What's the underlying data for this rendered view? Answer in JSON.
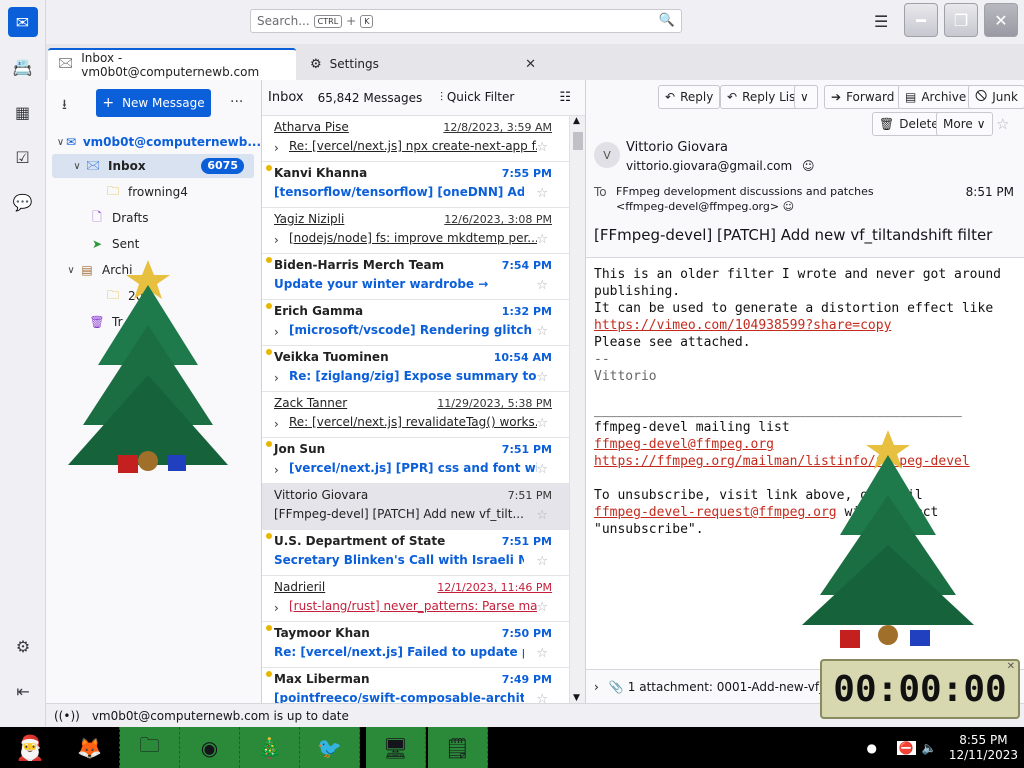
{
  "window": {
    "search_placeholder": "Search...",
    "shortcut_ctrl": "CTRL",
    "shortcut_plus": "+",
    "shortcut_k": "K"
  },
  "tabs": [
    {
      "label": "Inbox - vm0b0t@computernewb.com"
    },
    {
      "label": "Settings"
    }
  ],
  "folder_pane": {
    "new_message": "New Message",
    "more": "...",
    "account": "vm0b0t@computernewb...",
    "folders": [
      {
        "label": "Inbox",
        "badge": "6075"
      },
      {
        "label": "frowning4"
      },
      {
        "label": "Drafts"
      },
      {
        "label": "Sent"
      },
      {
        "label": "Archi"
      },
      {
        "label": "202"
      },
      {
        "label": "Tr"
      }
    ]
  },
  "thread_pane": {
    "folder_name": "Inbox",
    "count": "65,842 Messages",
    "quick_filter": "Quick Filter",
    "messages": [
      {
        "from": "Atharva Pise",
        "date": "12/8/2023, 3:59 AM",
        "subject": "Re: [vercel/next.js] npx create-next-app f...",
        "unread": false,
        "underline": true,
        "caret": true
      },
      {
        "from": "Kanvi Khanna",
        "date": "7:55 PM",
        "subject": "[tensorflow/tensorflow] [oneDNN] Add...",
        "unread": true,
        "underline": false,
        "caret": false
      },
      {
        "from": "Yagiz Nizipli",
        "date": "12/6/2023, 3:08 PM",
        "subject": "[nodejs/node] fs: improve mkdtemp per...",
        "unread": false,
        "underline": true,
        "caret": true
      },
      {
        "from": "Biden-Harris Merch Team",
        "date": "7:54 PM",
        "subject": "Update your winter wardrobe →",
        "unread": true,
        "underline": false,
        "caret": false
      },
      {
        "from": "Erich Gamma",
        "date": "1:32 PM",
        "subject": "[microsoft/vscode] Rendering glitch ...",
        "unread": true,
        "underline": false,
        "caret": true
      },
      {
        "from": "Veikka Tuominen",
        "date": "10:54 AM",
        "subject": "Re: [ziglang/zig] Expose summary to ...",
        "unread": true,
        "underline": false,
        "caret": true
      },
      {
        "from": "Zack Tanner",
        "date": "11/29/2023, 5:38 PM",
        "subject": "Re: [vercel/next.js] revalidateTag() works...",
        "unread": false,
        "underline": true,
        "caret": true
      },
      {
        "from": "Jon Sun",
        "date": "7:51 PM",
        "subject": "[vercel/next.js] [PPR] css and font wil...",
        "unread": true,
        "underline": false,
        "caret": true
      },
      {
        "from": "Vittorio Giovara",
        "date": "7:51 PM",
        "subject": "[FFmpeg-devel] [PATCH] Add new vf_tilt...",
        "unread": false,
        "underline": false,
        "caret": false,
        "selected": true
      },
      {
        "from": "U.S. Department of State",
        "date": "7:51 PM",
        "subject": "Secretary Blinken's Call with Israeli Mini...",
        "unread": true,
        "underline": false,
        "caret": false
      },
      {
        "from": "Nadrieril",
        "date": "12/1/2023, 11:46 PM",
        "subject": "[rust-lang/rust] never_patterns: Parse mat...",
        "unread": false,
        "underline": true,
        "caret": true,
        "red": true
      },
      {
        "from": "Taymoor Khan",
        "date": "7:50 PM",
        "subject": "Re: [vercel/next.js] Failed to update pre...",
        "unread": true,
        "underline": false,
        "caret": false
      },
      {
        "from": "Max Liberman",
        "date": "7:49 PM",
        "subject": "[pointfreeco/swift-composable-archit...",
        "unread": true,
        "underline": false,
        "caret": false
      }
    ]
  },
  "reader": {
    "buttons": {
      "reply": "Reply",
      "reply_list": "Reply List",
      "forward": "Forward",
      "archive": "Archive",
      "junk": "Junk",
      "delete": "Delete",
      "more": "More"
    },
    "avatar": "V",
    "sender_name": "Vittorio Giovara",
    "sender_email": "vittorio.giovara@gmail.com",
    "to_label": "To",
    "to_value": "FFmpeg development discussions and patches <ffmpeg-devel@ffmpeg.org>",
    "time": "8:51 PM",
    "subject": "[FFmpeg-devel] [PATCH] Add new vf_tiltandshift filter",
    "body_line1": "This is an older filter I wrote and never got around\npublishing.\nIt can be used to generate a distortion effect like",
    "link1": "https://vimeo.com/104938599?share=copy",
    "body_line2": "Please see attached.",
    "sig": "--\nVittorio",
    "rule": "_______________________________________________",
    "list_title": "ffmpeg-devel mailing list",
    "list_addr": "ffmpeg-devel@ffmpeg.org",
    "list_url": "https://ffmpeg.org/mailman/listinfo/ffmpeg-devel",
    "unsub_line": "To unsubscribe, visit link above, or email",
    "unsub_addr": "ffmpeg-devel-request@ffmpeg.org",
    "unsub_tail": " with subject",
    "unsub_word": "\"unsubscribe\".",
    "attachment": "1 attachment: 0001-Add-new-vf_ti..."
  },
  "status": {
    "text": "vm0b0t@computernewb.com is up to date"
  },
  "taskbar": {
    "time": "8:55 PM",
    "date": "12/11/2023"
  },
  "timer": {
    "value": "00:00:00"
  }
}
